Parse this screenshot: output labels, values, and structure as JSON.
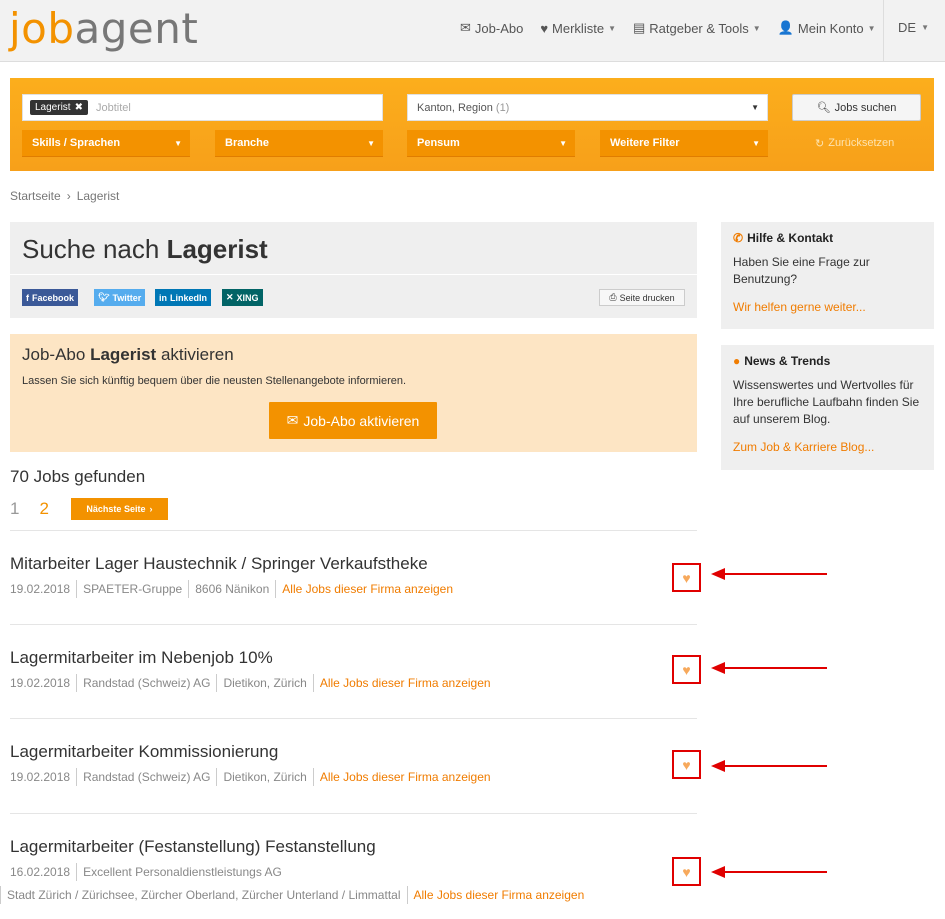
{
  "header": {
    "logo_part1": "job",
    "logo_part2": "agent",
    "nav": [
      {
        "icon": "envelope-icon",
        "label": "Job-Abo"
      },
      {
        "icon": "heart-icon",
        "label": "Merkliste"
      },
      {
        "icon": "book-icon",
        "label": "Ratgeber & Tools"
      },
      {
        "icon": "user-icon",
        "label": "Mein Konto"
      }
    ],
    "lang": "DE"
  },
  "search": {
    "chip_label": "Lagerist",
    "jobtitle_placeholder": "Jobtitel",
    "region_label": "Kanton, Region",
    "region_count": "(1)",
    "search_button": "Jobs suchen",
    "filters": [
      "Skills / Sprachen",
      "Branche",
      "Pensum",
      "Weitere Filter"
    ],
    "reset_label": "Zurücksetzen"
  },
  "breadcrumb": {
    "home": "Startseite",
    "current": "Lagerist"
  },
  "title": {
    "prefix": "Suche nach",
    "term": "Lagerist"
  },
  "share": {
    "facebook": "Facebook",
    "twitter": "Twitter",
    "linkedin": "LinkedIn",
    "xing": "XING",
    "print": "Seite drucken"
  },
  "abo": {
    "heading_prefix": "Job-Abo",
    "heading_term": "Lagerist",
    "heading_suffix": "aktivieren",
    "text": "Lassen Sie sich künftig bequem über die neusten Stellenangebote informieren.",
    "button": "Job-Abo aktivieren"
  },
  "results": {
    "count": "70 Jobs gefunden",
    "pages": [
      "1",
      "2"
    ],
    "next_label": "Nächste Seite"
  },
  "jobs": [
    {
      "title": "Mitarbeiter Lager Haustechnik / Springer Verkaufstheke",
      "date": "19.02.2018",
      "company": "SPAETER-Gruppe",
      "location": "8606 Nänikon",
      "link": "Alle Jobs dieser Firma anzeigen"
    },
    {
      "title": "Lagermitarbeiter im Nebenjob 10%",
      "date": "19.02.2018",
      "company": "Randstad (Schweiz) AG",
      "location": "Dietikon, Zürich",
      "link": "Alle Jobs dieser Firma anzeigen"
    },
    {
      "title": "Lagermitarbeiter Kommissionierung",
      "date": "19.02.2018",
      "company": "Randstad (Schweiz) AG",
      "location": "Dietikon, Zürich",
      "link": "Alle Jobs dieser Firma anzeigen"
    },
    {
      "title": "Lagermitarbeiter (Festanstellung) Festanstellung",
      "date": "16.02.2018",
      "company": "Excellent Personaldienstleistungs AG",
      "location": "Stadt Zürich / Zürichsee, Zürcher Oberland, Zürcher Unterland / Limmattal",
      "link": "Alle Jobs dieser Firma anzeigen"
    }
  ],
  "sidebar": {
    "help": {
      "title": "Hilfe & Kontakt",
      "text": "Haben Sie eine Frage zur Benutzung?",
      "link": "Wir helfen gerne weiter..."
    },
    "news": {
      "title": "News & Trends",
      "text": "Wissenswertes und Wertvolles für Ihre berufliche Laufbahn finden Sie auf unserem Blog.",
      "link": "Zum Job & Karriere Blog..."
    }
  },
  "colors": {
    "brand_orange": "#f39200",
    "highlight_red": "#e00000"
  }
}
